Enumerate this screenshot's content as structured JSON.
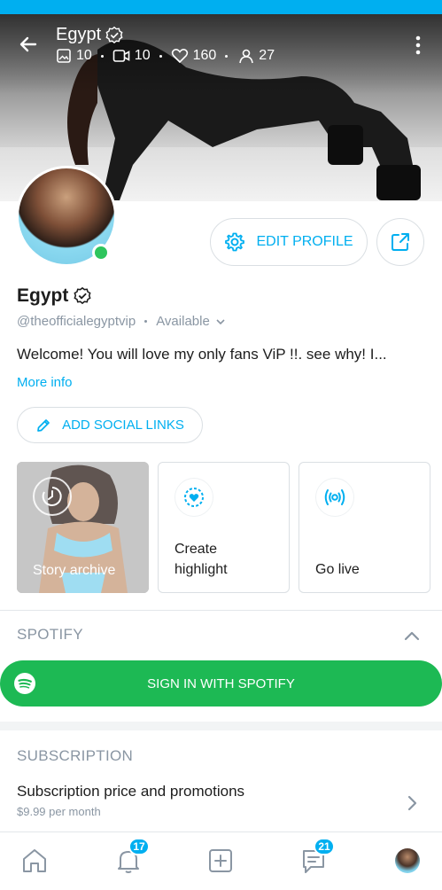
{
  "profile": {
    "name": "Egypt",
    "handle": "@theofficialegyptvip",
    "availability": "Available",
    "bio": "Welcome! You will love my only fans ViP !!. see why! I...",
    "more_info": "More info"
  },
  "stats": {
    "photos": "10",
    "videos": "10",
    "likes": "160",
    "fans": "27"
  },
  "actions": {
    "edit_profile": "EDIT PROFILE",
    "add_social_links": "ADD SOCIAL LINKS"
  },
  "highlights": {
    "story_archive": "Story archive",
    "create_highlight": "Create\nhighlight",
    "go_live": "Go live"
  },
  "spotify": {
    "heading": "SPOTIFY",
    "sign_in": "SIGN IN WITH SPOTIFY"
  },
  "subscription": {
    "heading": "SUBSCRIPTION",
    "title": "Subscription price and promotions",
    "price": "$9.99 per month"
  },
  "nav": {
    "notifications_count": "17",
    "messages_count": "21"
  },
  "colors": {
    "accent": "#00aff0",
    "spotify": "#1db954",
    "online": "#2ec55d",
    "muted": "#8a96a3"
  },
  "icons": [
    "back-arrow-icon",
    "verified-icon",
    "image-icon",
    "video-icon",
    "heart-icon",
    "fans-icon",
    "more-vertical-icon",
    "gear-icon",
    "share-icon",
    "pencil-icon",
    "clock-icon",
    "heart-badge-icon",
    "broadcast-icon",
    "chevron-up-icon",
    "spotify-icon",
    "chevron-right-icon",
    "home-icon",
    "bell-icon",
    "plus-square-icon",
    "messages-icon"
  ]
}
